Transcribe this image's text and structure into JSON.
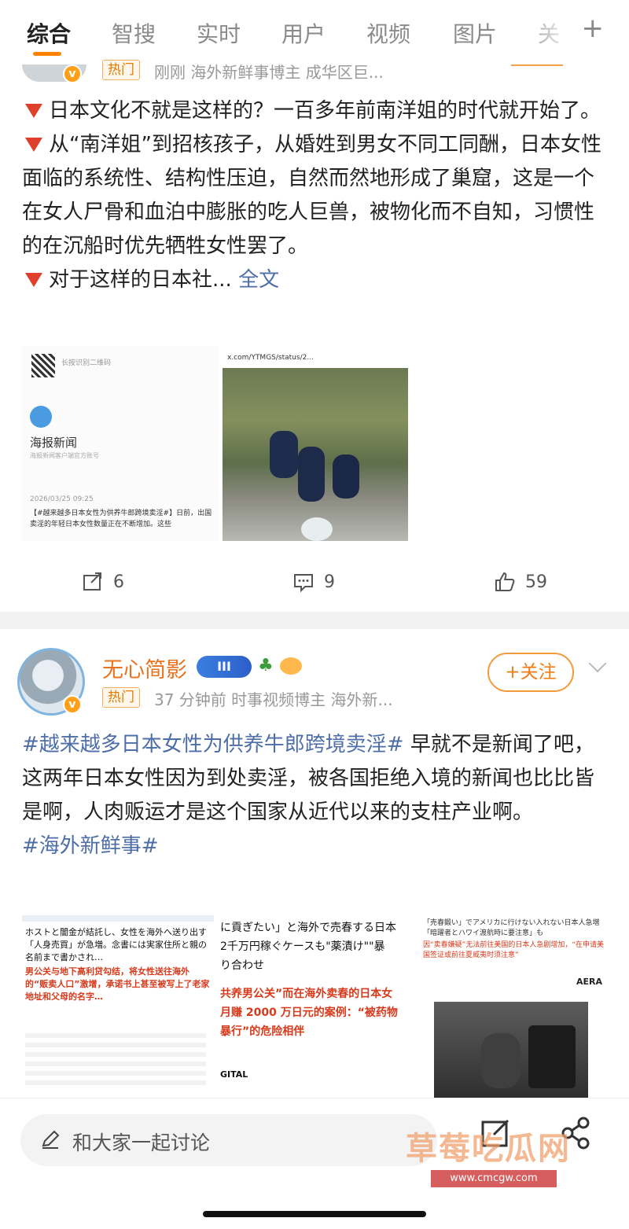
{
  "tabs": {
    "items": [
      "综合",
      "智搜",
      "实时",
      "用户",
      "视频",
      "图片",
      "关"
    ],
    "active_index": 0,
    "plus": "+"
  },
  "post1": {
    "hot_badge": "热门",
    "meta": "刚刚  海外新鲜事博主 成华区巨...",
    "paragraphs": [
      "日本文化不就是这样的？一百多年前南洋姐的时代就开始了。",
      "从“南洋姐”到招核孩子，从婚姓到男女不同工同酬，日本女性面临的系统性、结构性压迫，自然而然地形成了巢窟，这是一个在女人尸骨和血泊中膨胀的吃人巨兽，被物化而不自知，习惯性的在沉船时优先牺牲女性罢了。",
      "对于这样的日本社... "
    ],
    "full_text_link": "全文",
    "doc_thumb": {
      "qr_text": "长按识别二维码",
      "brand": "海报新闻",
      "sub": "海报新闻客户端官方账号",
      "date": "2026/03/25 09:25",
      "snippet": "【#越来越多日本女性为供养牛郎跨境卖淫#】日前，出国卖淫的年轻日本女性数量正在不断增加。这些"
    },
    "photo_thumb": {
      "url_text": "x.com/YTMGS/status/2..."
    },
    "actions": {
      "repost": "6",
      "comment": "9",
      "like": "59"
    }
  },
  "post2": {
    "username": "无心简影",
    "level": "III",
    "hot_badge": "热门",
    "meta": "37 分钟前  时事视频博主 海外新...",
    "follow_label": "+关注",
    "hashtag1": "#越来越多日本女性为供养牛郎跨境卖淫#",
    "text": " 早就不是新闻了吧，这两年日本女性因为到处卖淫，被各国拒绝入境的新闻也比比皆是啊，人肉贩运才是这个国家从近代以来的支柱产业啊。",
    "hashtag2": "#海外新鲜事#",
    "img1": {
      "jp": "ホストと闇金が結託し、女性を海外へ送り出す「人身売買」が急増。念書には実家住所と親の名前まで書かされ…",
      "cn": "男公关与地下高利贷勾结，将女性送往海外的“贩卖人口”激增，承诺书上甚至被写上了老家地址和父母的名字…"
    },
    "img2": {
      "jp1": "に貢ぎたい」と海外で売春する日本",
      "jp2": "2千万円稼ぐケースも\"薬漬け\"\"暴",
      "jp3": "り合わせ",
      "cn1": "共养男公关”而在海外卖春的日本女",
      "cn2": "月赚 2000 万日元的案例：“被药物",
      "cn3": "暴行”的危险相伴",
      "footer": "GITAL"
    },
    "img3": {
      "header": "「売春鍛い」でアメリカに行けない入れない日本人急増 「暗躍者とハワイ渡航時に要注意」も",
      "cn": "因“卖春嫌疑”无法前往美国的日本人急剧增加，“在申请美国签证或前往夏威夷时须注意”",
      "logo": "AERA"
    }
  },
  "comment_bar": {
    "placeholder": "和大家一起讨论"
  },
  "watermark": {
    "text": "草莓吃瓜网",
    "url": "www.cmcgw.com"
  }
}
